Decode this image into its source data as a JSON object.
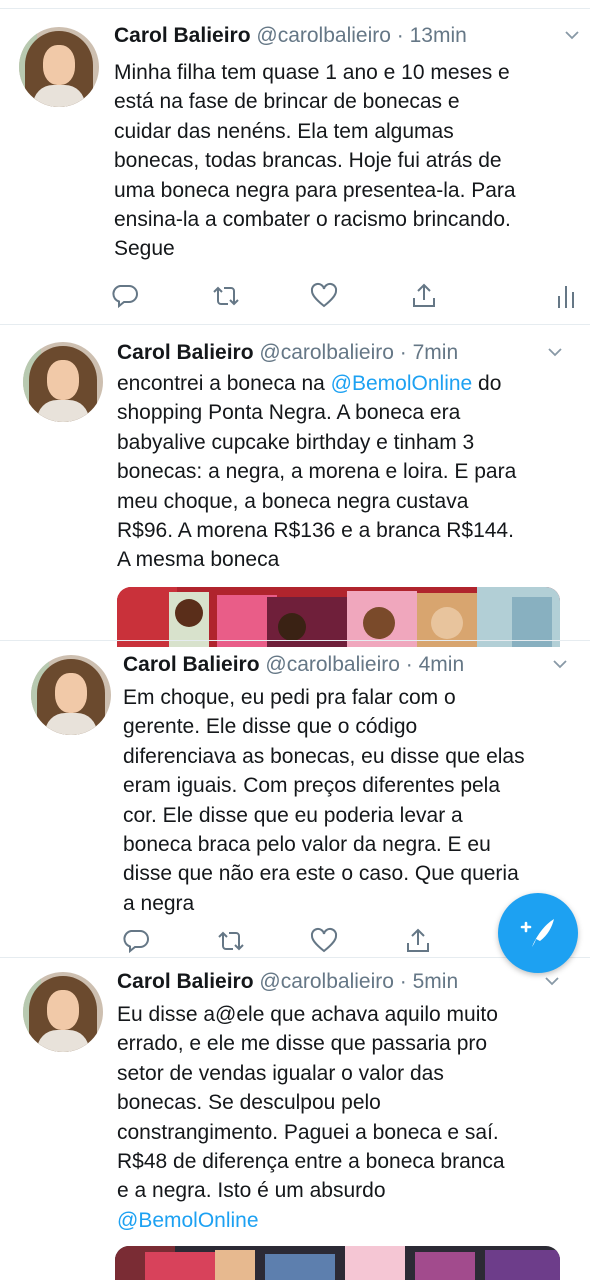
{
  "tweets": [
    {
      "name": "Carol Balieiro",
      "handle": "@carolbalieiro",
      "time": "13min",
      "text": "Minha filha tem quase 1 ano e 10 meses e\nestá na fase de brincar de bonecas e\ncuidar das nenéns. Ela tem algumas\nbonecas, todas brancas. Hoje fui atrás de\numa boneca negra para presentea-la. Para\nensina-la a combater o racismo brincando.\nSegue"
    },
    {
      "name": "Carol Balieiro",
      "handle": "@carolbalieiro",
      "time": "7min",
      "text_before": "encontrei a boneca na ",
      "mention": "@BemolOnline",
      "text_after": " do\nshopping Ponta Negra. A boneca era\nbabyalive cupcake birthday e tinham 3\nbonecas: a negra, a morena e loira. E para\nmeu choque, a boneca negra custava\nR$96. A morena R$136 e a branca R$144.\nA mesma boneca"
    },
    {
      "name": "Carol Balieiro",
      "handle": "@carolbalieiro",
      "time": "4min",
      "text": "Em choque, eu pedi pra falar com o\ngerente. Ele disse que o código\ndiferenciava as bonecas, eu disse que elas\neram iguais. Com preços diferentes pela\ncor. Ele disse que eu poderia levar a\nboneca braca pelo valor da negra. E eu\ndisse que não era este o caso. Que  queria\na negra"
    },
    {
      "name": "Carol Balieiro",
      "handle": "@carolbalieiro",
      "time": "5min",
      "text": "Eu disse a@ele que achava aquilo muito\nerrado, e ele me disse que passaria pro\nsetor de vendas igualar o valor das\nbonecas. Se desculpou pelo\nconstrangimento. Paguei a boneca e saí.\nR$48 de diferença entre a boneca branca\ne a negra. Isto é um absurdo",
      "mention": "@BemolOnline"
    }
  ],
  "icons": {
    "reply": "reply-icon",
    "retweet": "retweet-icon",
    "like": "heart-icon",
    "share": "share-icon",
    "analytics": "analytics-icon",
    "compose": "compose-tweet-icon",
    "menu": "chevron-down-icon"
  },
  "colors": {
    "accent": "#1da1f2",
    "secondary_text": "#657786",
    "icon": "#657786",
    "divider": "#e6ecf0"
  },
  "separator": " · "
}
